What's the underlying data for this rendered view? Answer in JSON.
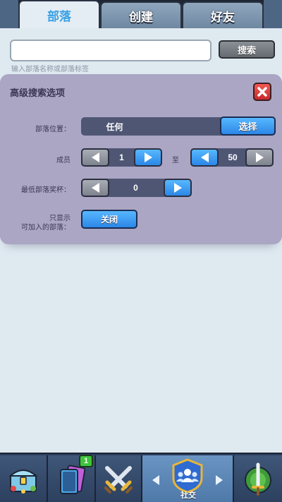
{
  "tabs": [
    {
      "label": "部落",
      "active": true
    },
    {
      "label": "创建",
      "active": false
    },
    {
      "label": "好友",
      "active": false
    }
  ],
  "search": {
    "value": "",
    "button_label": "搜索",
    "hint": "输入部落名称或部落标签"
  },
  "advanced": {
    "title": "高级搜索选项",
    "location": {
      "label": "部落位置：",
      "value": "任何",
      "button_label": "选择"
    },
    "members": {
      "label": "成员",
      "min": "1",
      "to_label": "至",
      "max": "50"
    },
    "min_trophies": {
      "label": "最低部落奖杯：",
      "value": "0"
    },
    "only_joinable": {
      "label_line1": "只显示",
      "label_line2": "可加入的部落：",
      "toggle_label": "关闭"
    }
  },
  "bottom_nav": {
    "items": [
      {
        "icon": "chest-icon"
      },
      {
        "icon": "cards-icon",
        "badge": "1"
      },
      {
        "icon": "crossed-swords-icon"
      },
      {
        "icon": "social-icon",
        "label": "社交",
        "active": true
      },
      {
        "icon": "laurel-sword-icon"
      }
    ]
  },
  "colors": {
    "accent_blue": "#3aa0e6",
    "panel": "#aba6c4",
    "close_red": "#e23b3b",
    "badge_green": "#3ec43b"
  }
}
